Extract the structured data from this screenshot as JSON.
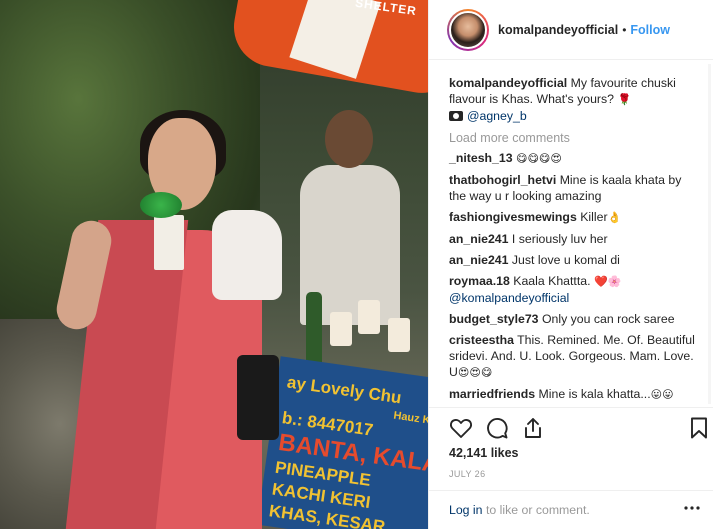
{
  "header": {
    "username": "komalpandeyofficial",
    "separator": "•",
    "follow_label": "Follow"
  },
  "photo": {
    "umbrella_text": "SHELTER",
    "cart_lines": [
      "ay Lovely Chu",
      "Hauz Khas",
      "b.: 8447017",
      "BANTA, KALA KHAT",
      "PINEAPPLE",
      "KACHI KERI",
      "KHAS, KESAR"
    ]
  },
  "caption": {
    "user": "komalpandeyofficial",
    "text": "My favourite chuski flavour is Khas. What's yours?",
    "emoji": "🌹",
    "credit": "@agney_b"
  },
  "load_more": "Load more comments",
  "comments": [
    {
      "user": "_nitesh_13",
      "text": "",
      "emoji": "😋😋😋😍"
    },
    {
      "user": "thatbohogirl_hetvi",
      "text": "Mine is kaala khata by the way u r looking amazing",
      "emoji": ""
    },
    {
      "user": "fashiongivesmewings",
      "text": "Killer",
      "emoji": "👌"
    },
    {
      "user": "an_nie241",
      "text": "I seriously luv her",
      "emoji": ""
    },
    {
      "user": "an_nie241",
      "text": "Just love u komal di",
      "emoji": ""
    },
    {
      "user": "roymaa.18",
      "text": "Kaala Khattta.",
      "emoji": "❤️🌸",
      "mention": "@komalpandeyofficial"
    },
    {
      "user": "budget_style73",
      "text": "Only you can rock saree",
      "emoji": ""
    },
    {
      "user": "cristeestha",
      "text": "This. Remined. Me. Of. Beautiful sridevi. And. U. Look. Gorgeous. Mam. Love. U",
      "emoji": "😍😍😋"
    },
    {
      "user": "marriedfriends",
      "text": "Mine is kala khatta...",
      "emoji": "😛😛"
    }
  ],
  "likes": "42,141 likes",
  "date": "JULY 26",
  "footer": {
    "login_label": "Log in",
    "rest": "to like or comment."
  },
  "icons": {
    "like": "heart-icon",
    "comment": "comment-icon",
    "share": "share-icon",
    "save": "bookmark-icon",
    "more": "more-options-icon"
  },
  "colors": {
    "follow": "#3897f0",
    "link": "#003569",
    "muted": "#999999"
  }
}
